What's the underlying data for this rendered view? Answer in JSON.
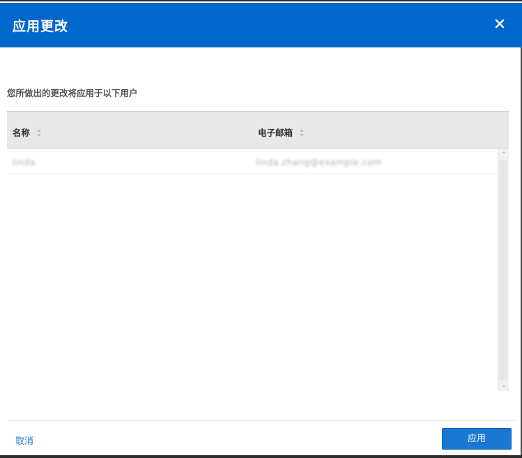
{
  "dialog": {
    "title": "应用更改",
    "close_icon": "close-icon",
    "intro_text": "您所做出的更改将应用于以下用户",
    "accent_color": "#0067cc"
  },
  "table": {
    "columns": [
      {
        "label": "名称",
        "sort_icon": "sort-icon"
      },
      {
        "label": "电子邮箱",
        "sort_icon": "sort-icon"
      }
    ],
    "rows": [
      {
        "name": "linda",
        "email": "linda.zhang@example.com"
      }
    ]
  },
  "footer": {
    "cancel_label": "取消",
    "apply_label": "应用"
  }
}
